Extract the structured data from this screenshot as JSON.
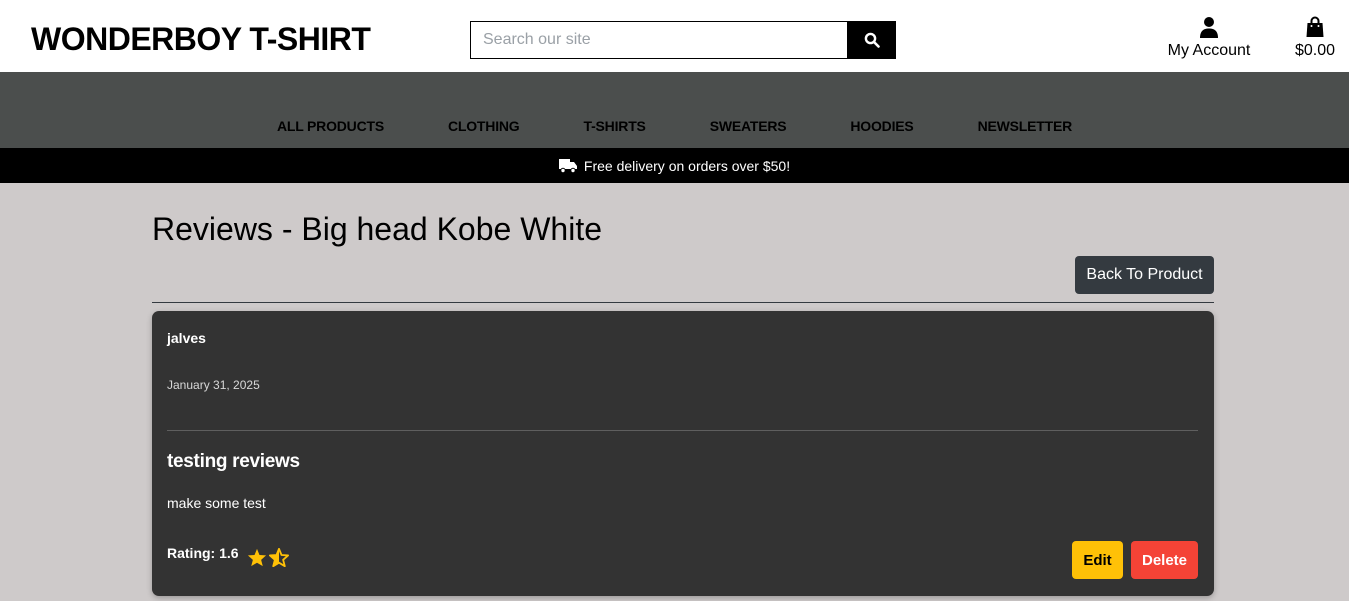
{
  "header": {
    "brand": "WONDERBOY T-SHIRT",
    "search_placeholder": "Search our site",
    "account_label": "My Account",
    "cart_total": "$0.00"
  },
  "nav": {
    "items": [
      "ALL PRODUCTS",
      "CLOTHING",
      "T-SHIRTS",
      "SWEATERS",
      "HOODIES",
      "NEWSLETTER"
    ]
  },
  "promo": {
    "text": "Free delivery on orders over $50!",
    "icon": "truck-icon"
  },
  "page": {
    "title": "Reviews - Big head Kobe White",
    "back_button": "Back To Product"
  },
  "review": {
    "author": "jalves",
    "date": "January 31, 2025",
    "title": "testing reviews",
    "body": "make some test",
    "rating_label": "Rating: 1.6",
    "rating_value": 1.6,
    "edit_label": "Edit",
    "delete_label": "Delete"
  },
  "colors": {
    "nav_bg": "#4b4e4d",
    "promo_bg": "#000000",
    "page_bg": "#cecaca",
    "card_bg": "#333333",
    "star": "#ffc107",
    "edit": "#ffc107",
    "delete": "#f44336",
    "back_button": "#343a40"
  }
}
